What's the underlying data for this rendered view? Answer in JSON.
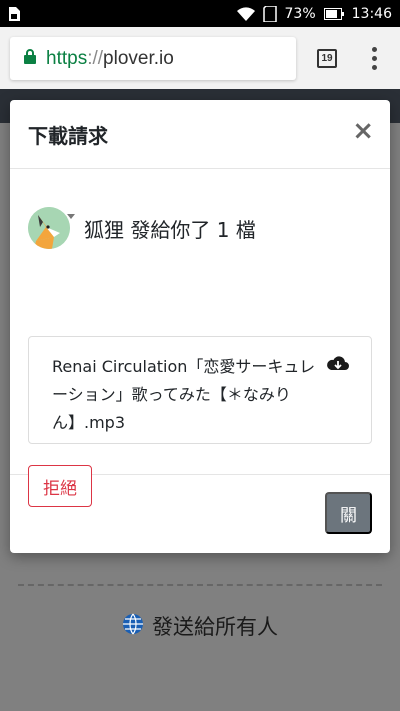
{
  "status_bar": {
    "battery_percent": "73%",
    "time": "13:46"
  },
  "browser": {
    "url_scheme": "https",
    "url_separator": "://",
    "url_host": "plover.io",
    "tab_count": "19"
  },
  "page": {
    "send_all_label": "發送給所有人"
  },
  "modal": {
    "title": "下載請求",
    "close_symbol": "×",
    "sender_message": "狐狸 發給你了 1 檔",
    "file_name": "Renai Circulation「恋愛サーキュレーション」歌ってみた【＊なみりん】.mp3",
    "reject_label": "拒絕",
    "close_label": "關"
  },
  "colors": {
    "url_scheme": "#0b8043",
    "danger": "#dc3545",
    "secondary": "#6c757d",
    "avatar_bg": "#a7d6b3",
    "globe": "#1a5fb4"
  }
}
